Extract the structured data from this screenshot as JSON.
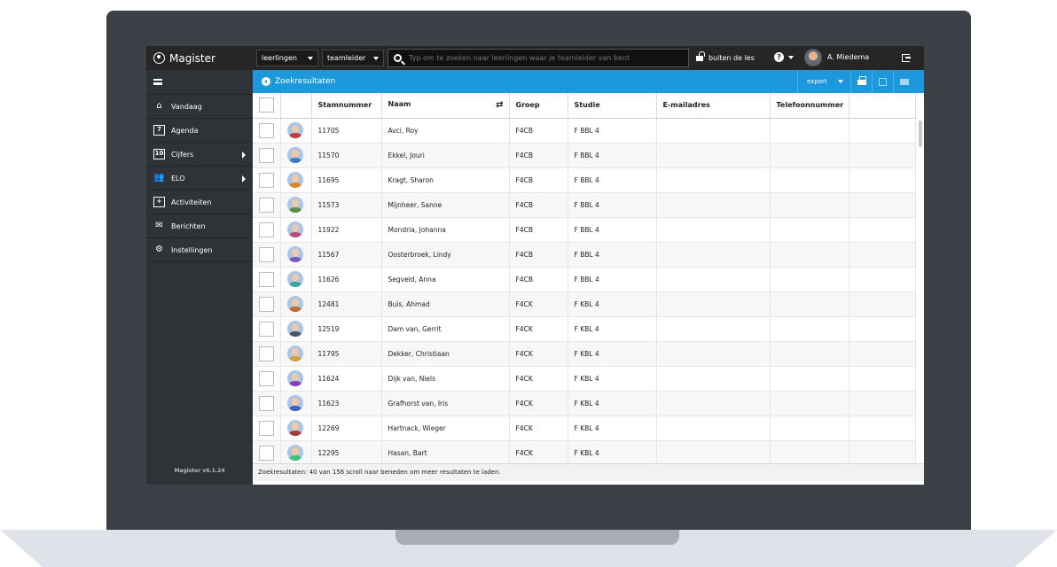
{
  "app": {
    "title": "Magister",
    "version": "Magister v6.1.24"
  },
  "topbar": {
    "select_group": "leerlingen",
    "select_role": "teamleider",
    "search_placeholder": "Typ om te zoeken naar leerlingen waar je teamleider van bent",
    "lock_label": "buiten de les",
    "help_label": "?",
    "user_name": "A. Miedema"
  },
  "sidebar": {
    "items": [
      {
        "label": "Vandaag",
        "icon": "home-icon",
        "glyph": "⌂",
        "box": false,
        "arrow": false
      },
      {
        "label": "Agenda",
        "icon": "calendar-icon",
        "glyph": "7",
        "box": true,
        "arrow": false
      },
      {
        "label": "Cijfers",
        "icon": "grades-icon",
        "glyph": "10",
        "box": true,
        "arrow": true
      },
      {
        "label": "ELO",
        "icon": "users-icon",
        "glyph": "👥",
        "box": false,
        "arrow": true
      },
      {
        "label": "Activiteiten",
        "icon": "activity-calendar-icon",
        "glyph": "+",
        "box": true,
        "arrow": false
      },
      {
        "label": "Berichten",
        "icon": "envelope-icon",
        "glyph": "✉",
        "box": false,
        "arrow": false
      },
      {
        "label": "Instellingen",
        "icon": "gear-icon",
        "glyph": "⚙",
        "box": false,
        "arrow": false
      }
    ]
  },
  "content": {
    "title": "Zoekresultaten",
    "export_label": "export"
  },
  "table": {
    "columns": [
      "",
      "",
      "Stamnummer",
      "Naam",
      "Groep",
      "Studie",
      "E-mailadres",
      "Telefoonnummer",
      ""
    ],
    "rows": [
      {
        "stamnummer": "11705",
        "naam": "Avci, Roy",
        "groep": "F4CB",
        "studie": "F BBL 4"
      },
      {
        "stamnummer": "11570",
        "naam": "Ekkel, Jouri",
        "groep": "F4CB",
        "studie": "F BBL 4"
      },
      {
        "stamnummer": "11695",
        "naam": "Kragt, Sharon",
        "groep": "F4CB",
        "studie": "F BBL 4"
      },
      {
        "stamnummer": "11573",
        "naam": "Mijnheer, Sanne",
        "groep": "F4CB",
        "studie": "F BBL 4"
      },
      {
        "stamnummer": "11922",
        "naam": "Mondria, Johanna",
        "groep": "F4CB",
        "studie": "F BBL 4"
      },
      {
        "stamnummer": "11567",
        "naam": "Oosterbroek, Lindy",
        "groep": "F4CB",
        "studie": "F BBL 4"
      },
      {
        "stamnummer": "11626",
        "naam": "Segveld, Anna",
        "groep": "F4CB",
        "studie": "F BBL 4"
      },
      {
        "stamnummer": "12481",
        "naam": "Buis, Ahmad",
        "groep": "F4CK",
        "studie": "F KBL 4"
      },
      {
        "stamnummer": "12519",
        "naam": "Dam van, Gerrit",
        "groep": "F4CK",
        "studie": "F KBL 4"
      },
      {
        "stamnummer": "11795",
        "naam": "Dekker, Christiaan",
        "groep": "F4CK",
        "studie": "F KBL 4"
      },
      {
        "stamnummer": "11624",
        "naam": "Dijk van, Niels",
        "groep": "F4CK",
        "studie": "F KBL 4"
      },
      {
        "stamnummer": "11623",
        "naam": "Grafhorst van, Iris",
        "groep": "F4CK",
        "studie": "F KBL 4"
      },
      {
        "stamnummer": "12269",
        "naam": "Hartnack, Wieger",
        "groep": "F4CK",
        "studie": "F KBL 4"
      },
      {
        "stamnummer": "12295",
        "naam": "Hasan, Bart",
        "groep": "F4CK",
        "studie": "F KBL 4"
      }
    ]
  },
  "status_text": "Zoekresultaten: 40 van 156 scroll naar beneden om meer resultaten te laden.",
  "colors": {
    "accent": "#1e98dd",
    "topbar": "#262626",
    "sidebar": "#2f3337"
  }
}
